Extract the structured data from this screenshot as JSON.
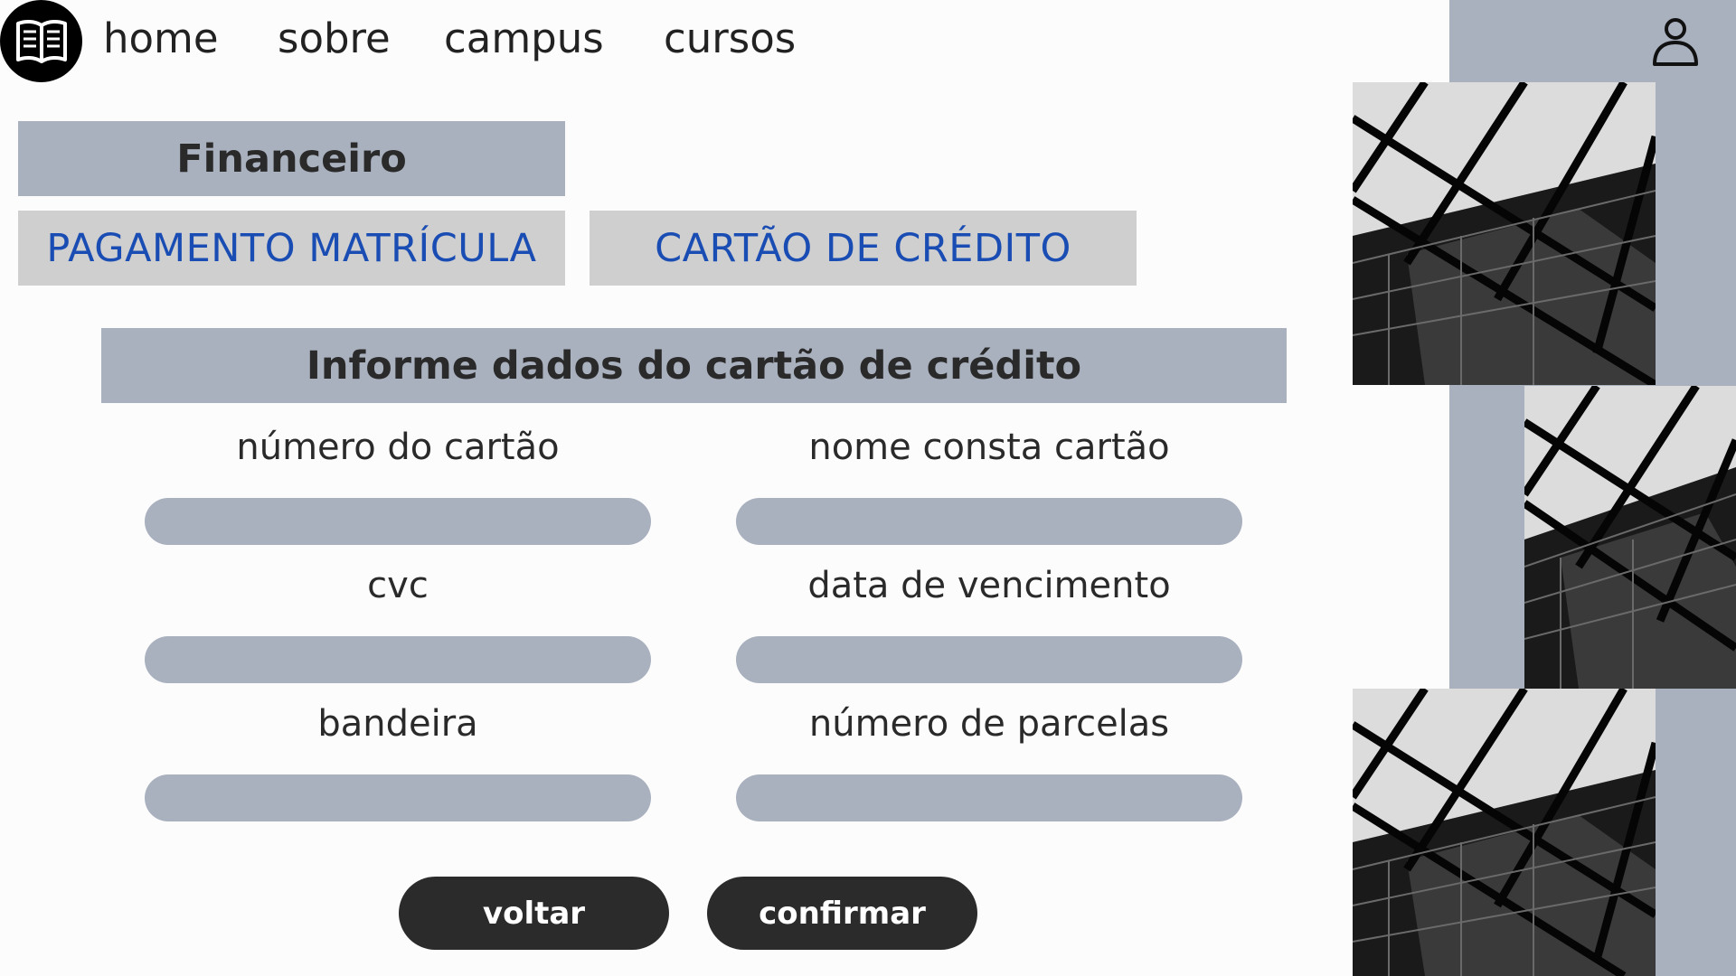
{
  "nav": {
    "logo_icon": "open-book-icon",
    "links": [
      "home",
      "sobre",
      "campus",
      "cursos"
    ],
    "user_icon": "user-icon"
  },
  "financeiro": {
    "title": "Financeiro",
    "tabs": [
      "PAGAMENTO MATRÍCULA",
      "CARTÃO DE CRÉDITO"
    ]
  },
  "form": {
    "title": "Informe dados do cartão de crédito",
    "fields": {
      "card_number": {
        "label": "número do cartão",
        "value": ""
      },
      "card_name": {
        "label": "nome consta cartão",
        "value": ""
      },
      "cvc": {
        "label": "cvc",
        "value": ""
      },
      "expiry": {
        "label": "data de vencimento",
        "value": ""
      },
      "brand": {
        "label": "bandeira",
        "value": ""
      },
      "installments": {
        "label": "número de parcelas",
        "value": ""
      }
    },
    "buttons": {
      "back": "voltar",
      "confirm": "confirmar"
    }
  },
  "colors": {
    "panel": "#a9b0be",
    "tab": "#cfcfcf",
    "tab_text": "#1a4db3",
    "button": "#2b2b2b"
  }
}
